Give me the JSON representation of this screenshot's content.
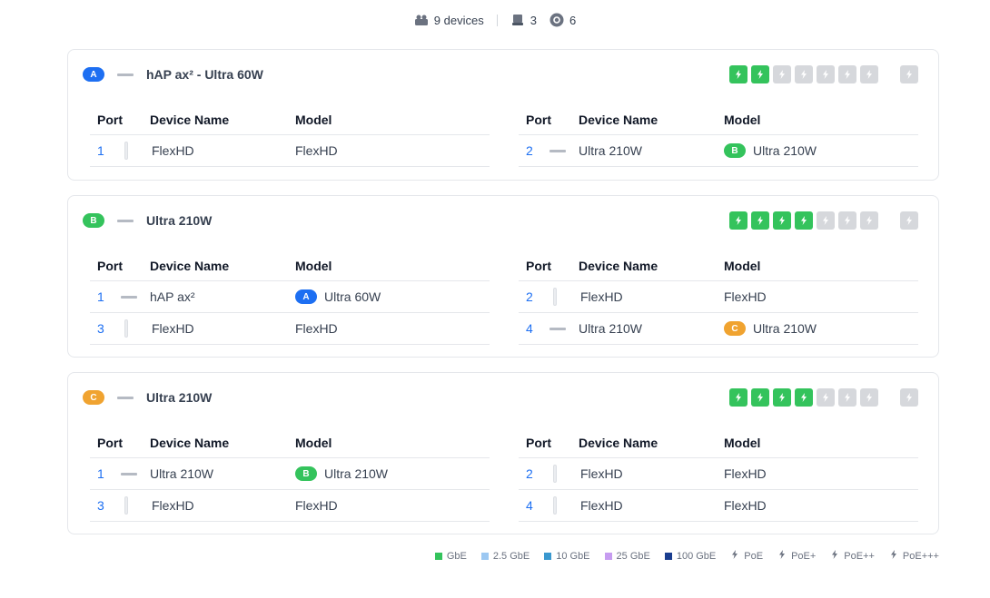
{
  "summary": {
    "devices_label": "9 devices",
    "switches_count": "3",
    "aps_count": "6",
    "icons": [
      "devices-icon",
      "switch-icon",
      "access-point-icon"
    ]
  },
  "cards": [
    {
      "badge": "A",
      "color": "#1d6ff2",
      "title": "hAP ax² - Ultra 60W",
      "ports_on": 2,
      "ports_total": 7,
      "left": {
        "headers": [
          "Port",
          "Device Name",
          "Model"
        ],
        "rows": [
          {
            "port": "1",
            "name": "FlexHD",
            "model": "FlexHD",
            "badge": ""
          }
        ]
      },
      "right": {
        "headers": [
          "Port",
          "Device Name",
          "Model"
        ],
        "rows": [
          {
            "port": "2",
            "name": "Ultra 210W",
            "model": "Ultra 210W",
            "badge": "B"
          }
        ]
      }
    },
    {
      "badge": "B",
      "color": "#34c35c",
      "title": "Ultra 210W",
      "ports_on": 4,
      "ports_total": 7,
      "left": {
        "headers": [
          "Port",
          "Device Name",
          "Model"
        ],
        "rows": [
          {
            "port": "1",
            "name": "hAP ax²",
            "model": "Ultra 60W",
            "badge": "A"
          },
          {
            "port": "3",
            "name": "FlexHD",
            "model": "FlexHD",
            "badge": ""
          }
        ]
      },
      "right": {
        "headers": [
          "Port",
          "Device Name",
          "Model"
        ],
        "rows": [
          {
            "port": "2",
            "name": "FlexHD",
            "model": "FlexHD",
            "badge": ""
          },
          {
            "port": "4",
            "name": "Ultra 210W",
            "model": "Ultra 210W",
            "badge": "C"
          }
        ]
      }
    },
    {
      "badge": "C",
      "color": "#f0a330",
      "title": "Ultra 210W",
      "ports_on": 4,
      "ports_total": 7,
      "left": {
        "headers": [
          "Port",
          "Device Name",
          "Model"
        ],
        "rows": [
          {
            "port": "1",
            "name": "Ultra 210W",
            "model": "Ultra 210W",
            "badge": "B"
          },
          {
            "port": "3",
            "name": "FlexHD",
            "model": "FlexHD",
            "badge": ""
          }
        ]
      },
      "right": {
        "headers": [
          "Port",
          "Device Name",
          "Model"
        ],
        "rows": [
          {
            "port": "2",
            "name": "FlexHD",
            "model": "FlexHD",
            "badge": ""
          },
          {
            "port": "4",
            "name": "FlexHD",
            "model": "FlexHD",
            "badge": ""
          }
        ]
      }
    }
  ],
  "legend": [
    {
      "label": "GbE",
      "color": "#34c35c",
      "kind": "swatch"
    },
    {
      "label": "2.5 GbE",
      "color": "#9cc8f2",
      "kind": "swatch"
    },
    {
      "label": "10 GbE",
      "color": "#3a98cf",
      "kind": "swatch"
    },
    {
      "label": "25 GbE",
      "color": "#c69cf0",
      "kind": "swatch"
    },
    {
      "label": "100 GbE",
      "color": "#1a3d8f",
      "kind": "swatch"
    },
    {
      "label": "PoE",
      "kind": "bolt",
      "icon": "poe-icon"
    },
    {
      "label": "PoE+",
      "kind": "bolt",
      "icon": "poe-plus-icon"
    },
    {
      "label": "PoE++",
      "kind": "bolt",
      "icon": "poe-plus-plus-icon"
    },
    {
      "label": "PoE+++",
      "kind": "bolt",
      "icon": "poe-plus-plus-plus-icon"
    }
  ]
}
